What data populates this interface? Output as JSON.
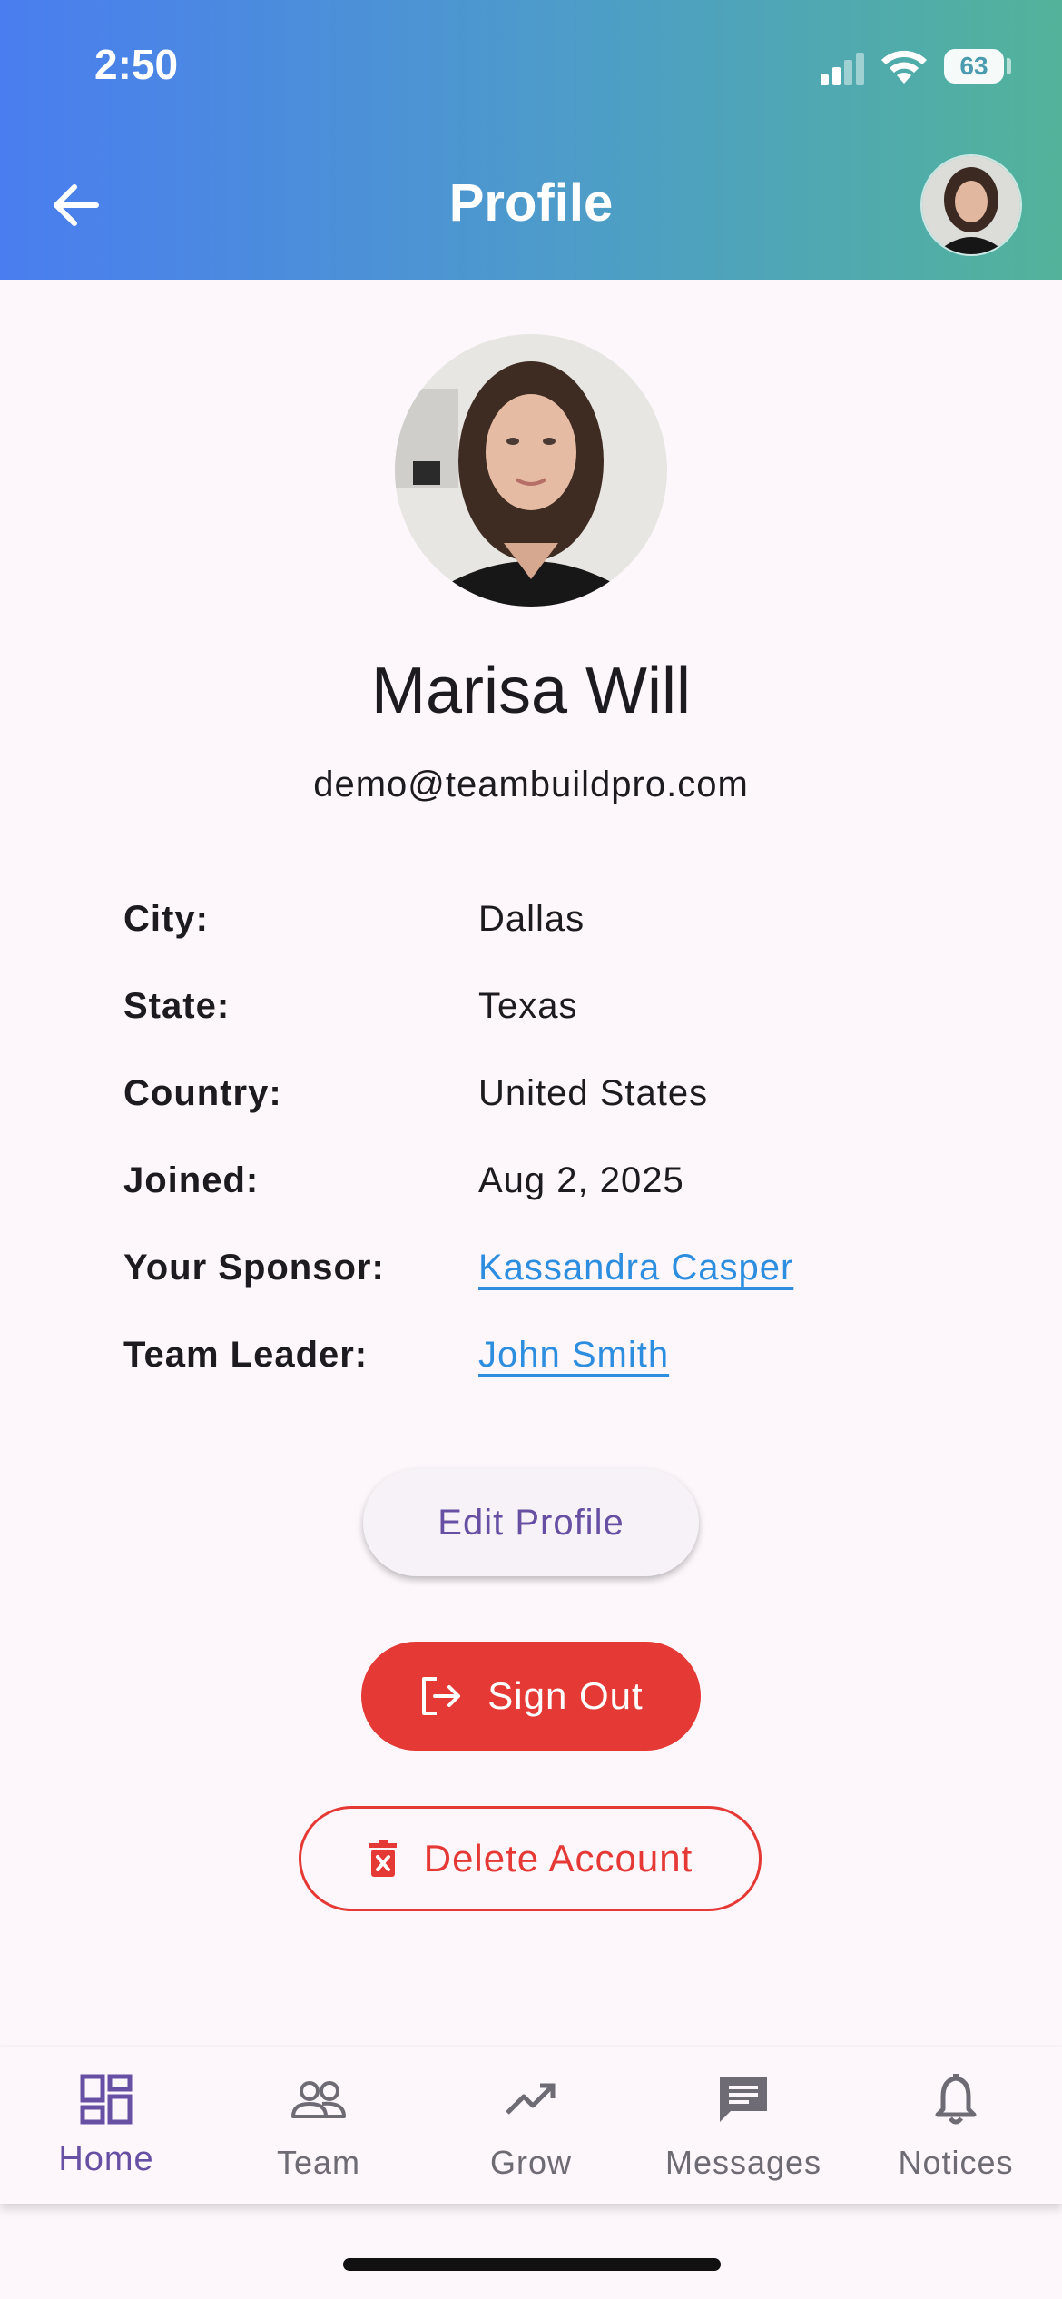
{
  "status_bar": {
    "time": "2:50",
    "battery": "63"
  },
  "header": {
    "title": "Profile"
  },
  "profile": {
    "name": "Marisa Will",
    "email": "demo@teambuildpro.com",
    "fields": [
      {
        "label": "City:",
        "value": "Dallas"
      },
      {
        "label": "State:",
        "value": "Texas"
      },
      {
        "label": "Country:",
        "value": "United States"
      },
      {
        "label": "Joined:",
        "value": "Aug 2, 2025"
      },
      {
        "label": "Your Sponsor:",
        "value": "Kassandra Casper"
      },
      {
        "label": "Team Leader:",
        "value": "John Smith"
      }
    ]
  },
  "actions": {
    "edit_label": "Edit Profile",
    "signout_label": "Sign Out",
    "delete_label": "Delete Account"
  },
  "nav": {
    "items": [
      {
        "label": "Home",
        "icon": "dashboard-icon"
      },
      {
        "label": "Team",
        "icon": "people-icon"
      },
      {
        "label": "Grow",
        "icon": "trending-up-icon"
      },
      {
        "label": "Messages",
        "icon": "message-icon"
      },
      {
        "label": "Notices",
        "icon": "bell-icon"
      }
    ],
    "active": "Home"
  },
  "colors": {
    "accent": "#6750a4",
    "danger": "#e53935",
    "link": "#2d8ee0",
    "header_gradient_start": "#4a7df0",
    "header_gradient_end": "#52b39a"
  }
}
